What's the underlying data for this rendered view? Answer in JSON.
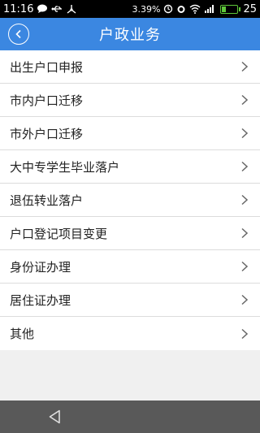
{
  "status_bar": {
    "time": "11:16",
    "battery_pct": "3.39%",
    "battery_level": "25",
    "icons": [
      "message-icon",
      "usb-icon",
      "network-icon",
      "sync-icon",
      "alarm-icon",
      "wifi-icon",
      "signal-icon",
      "battery-icon"
    ]
  },
  "header": {
    "title": "户政业务",
    "back_icon": "back-circle-icon"
  },
  "menu": {
    "items": [
      {
        "label": "出生户口申报"
      },
      {
        "label": "市内户口迁移"
      },
      {
        "label": "市外户口迁移"
      },
      {
        "label": "大中专学生毕业落户"
      },
      {
        "label": "退伍转业落户"
      },
      {
        "label": "户口登记项目变更"
      },
      {
        "label": "身份证办理"
      },
      {
        "label": "居住证办理"
      },
      {
        "label": "其他"
      }
    ],
    "chevron_icon": "chevron-right-icon"
  },
  "nav_bar": {
    "back_icon": "nav-back-triangle-icon"
  },
  "colors": {
    "header_bg": "#3b87e1",
    "status_bg": "#000000",
    "nav_bg": "#595959",
    "battery": "#5ec73a",
    "page_bg": "#f0f0f0"
  }
}
